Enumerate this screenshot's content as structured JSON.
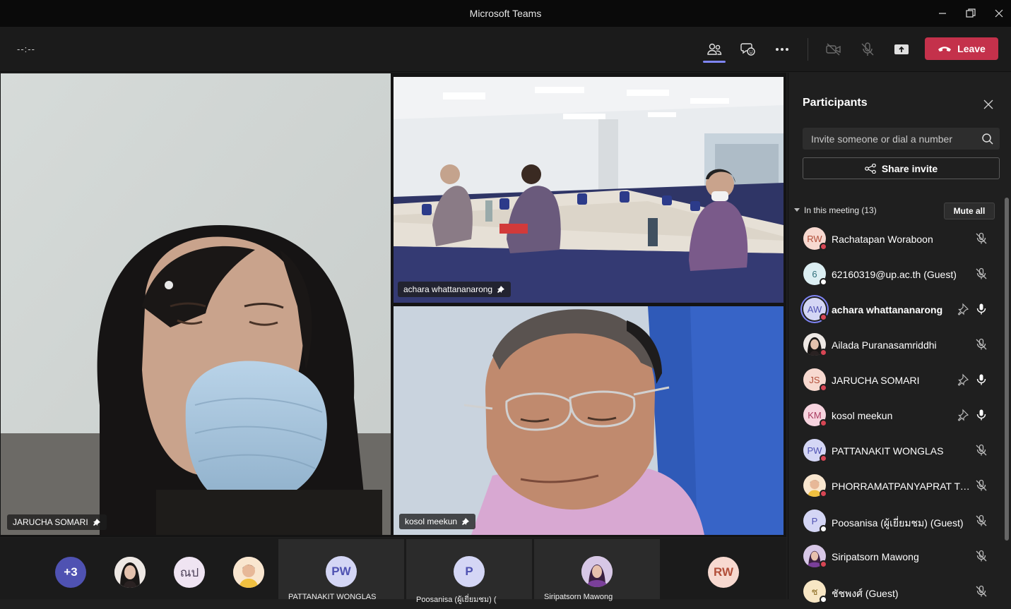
{
  "window": {
    "title": "Microsoft Teams"
  },
  "toolbar": {
    "timer": "--:--",
    "leave_label": "Leave",
    "accent_color": "#7f85f5",
    "leave_color": "#c4314b"
  },
  "stage": {
    "tiles": [
      {
        "name": "JARUCHA SOMARI",
        "pinned": true
      },
      {
        "name": "achara whattananarong",
        "pinned": true
      },
      {
        "name": "kosol meekun",
        "pinned": true
      }
    ]
  },
  "strip": {
    "overflow_label": "+3",
    "small_avatars": [
      {
        "kind": "photo",
        "name": "Ailada Puranasamriddhi"
      },
      {
        "kind": "initials",
        "initials": "ณป"
      },
      {
        "kind": "photo",
        "name": "PHORRAMATPANYAPRAT"
      }
    ],
    "tiles": [
      {
        "initials": "PW",
        "name": "PATTANAKIT WONGLAS"
      },
      {
        "initials": "P",
        "name": "Poosanisa (ผู้เยี่ยมชม) ("
      },
      {
        "initials": "",
        "name": "Siripatsorn Mawong"
      },
      {
        "initials": "RW",
        "name": ""
      }
    ]
  },
  "panel": {
    "title": "Participants",
    "search_placeholder": "Invite someone or dial a number",
    "share_label": "Share invite",
    "section_label": "In this meeting (13)",
    "mute_all_label": "Mute all",
    "participants": [
      {
        "initials": "RW",
        "name": "Rachatapan Woraboon",
        "status": "busy",
        "mic": "muted",
        "pin": false
      },
      {
        "initials": "6",
        "name": "62160319@up.ac.th (Guest)",
        "status": "offline",
        "mic": "muted",
        "pin": false
      },
      {
        "initials": "AW",
        "name": "achara whattananarong",
        "status": "busy",
        "mic": "on",
        "pin": true,
        "speaking": true
      },
      {
        "initials": "",
        "name": "Ailada Puranasamriddhi",
        "status": "busy",
        "mic": "muted",
        "pin": false,
        "photo": true
      },
      {
        "initials": "JS",
        "name": "JARUCHA SOMARI",
        "status": "busy",
        "mic": "on",
        "pin": true
      },
      {
        "initials": "KM",
        "name": "kosol meekun",
        "status": "busy",
        "mic": "on",
        "pin": true
      },
      {
        "initials": "PW",
        "name": "PATTANAKIT WONGLAS",
        "status": "busy",
        "mic": "muted",
        "pin": false
      },
      {
        "initials": "",
        "name": "PHORRAMATPANYAPRAT TO...",
        "status": "busy",
        "mic": "muted",
        "pin": false,
        "photo": true
      },
      {
        "initials": "P",
        "name": "Poosanisa (ผู้เยี่ยมชม) (Guest)",
        "status": "offline",
        "mic": "muted",
        "pin": false
      },
      {
        "initials": "",
        "name": "Siripatsorn Mawong",
        "status": "busy",
        "mic": "muted",
        "pin": false,
        "photo": true
      },
      {
        "initials": "ช",
        "name": "ชัชพงศ์ (Guest)",
        "status": "offline",
        "mic": "muted",
        "pin": false
      }
    ]
  }
}
